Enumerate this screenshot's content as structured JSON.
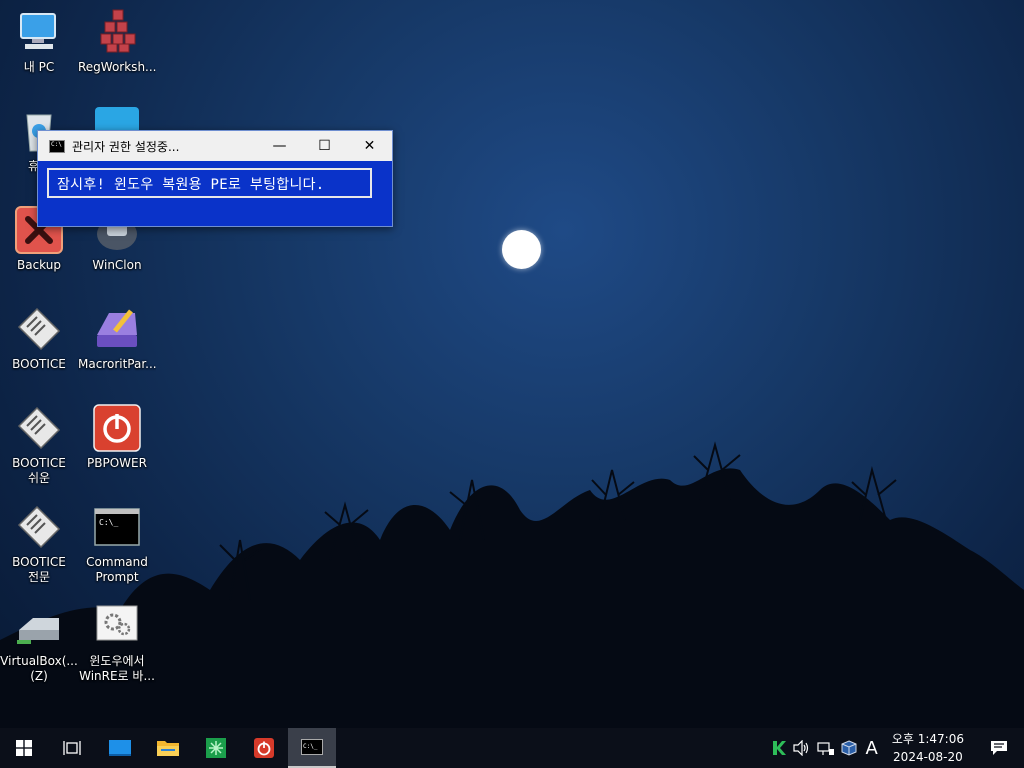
{
  "desktop": {
    "icons": [
      {
        "label": "내 PC"
      },
      {
        "label": "RegWorksh..."
      },
      {
        "label": "휴지"
      },
      {
        "label": ""
      },
      {
        "label": "Backup"
      },
      {
        "label": "WinClon"
      },
      {
        "label": "BOOTICE"
      },
      {
        "label": "MacroritPar..."
      },
      {
        "label": "BOOTICE\n쉬운"
      },
      {
        "label": "PBPOWER"
      },
      {
        "label": "BOOTICE\n전문"
      },
      {
        "label": "Command\nPrompt"
      },
      {
        "label": "VirtualBox(...\n(Z)"
      },
      {
        "label": "윈도우에서\nWinRE로 바..."
      }
    ]
  },
  "window": {
    "title": "관리자 권한 설정중...",
    "message": "잠시후! 윈도우 복원용 PE로 부팅합니다.",
    "minimize_glyph": "—",
    "maximize_glyph": "☐",
    "close_glyph": "✕"
  },
  "taskbar": {
    "buttons": [
      "start-icon",
      "task-view-icon",
      "desktop-icon",
      "file-explorer-icon",
      "partition-tool-icon",
      "power-icon",
      "command-prompt-icon"
    ],
    "tray": {
      "ime_indicator": "A",
      "clock_time": "오후 1:47:06",
      "clock_date": "2024-08-20"
    }
  },
  "colors": {
    "window_body": "#0a33c9",
    "taskbar": "#0b0f19",
    "accent_green": "#2ebd59"
  }
}
